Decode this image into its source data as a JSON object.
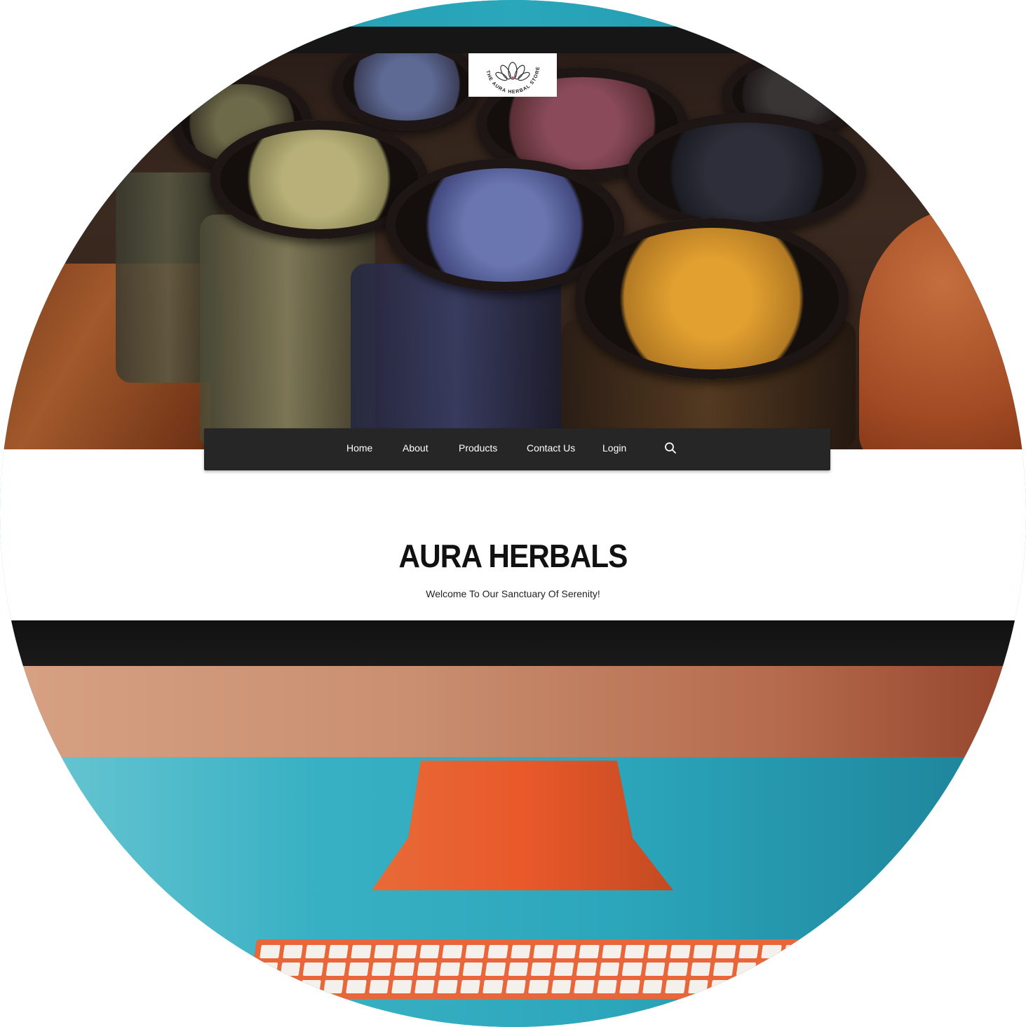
{
  "logo": {
    "text": "THE AURA HERBAL STORE"
  },
  "nav": {
    "items": [
      {
        "label": "Home"
      },
      {
        "label": "About"
      },
      {
        "label": "Products"
      },
      {
        "label": "Contact Us"
      },
      {
        "label": "Login"
      }
    ],
    "search_icon": "search-icon"
  },
  "hero": {
    "title": "AURA HERBALS",
    "subtitle": "Welcome To Our Sanctuary Of Serenity!"
  },
  "colors": {
    "navbar": "#262626",
    "desk": "#2ca6bb",
    "stand": "#e9592a",
    "chin": "#c98f70"
  }
}
